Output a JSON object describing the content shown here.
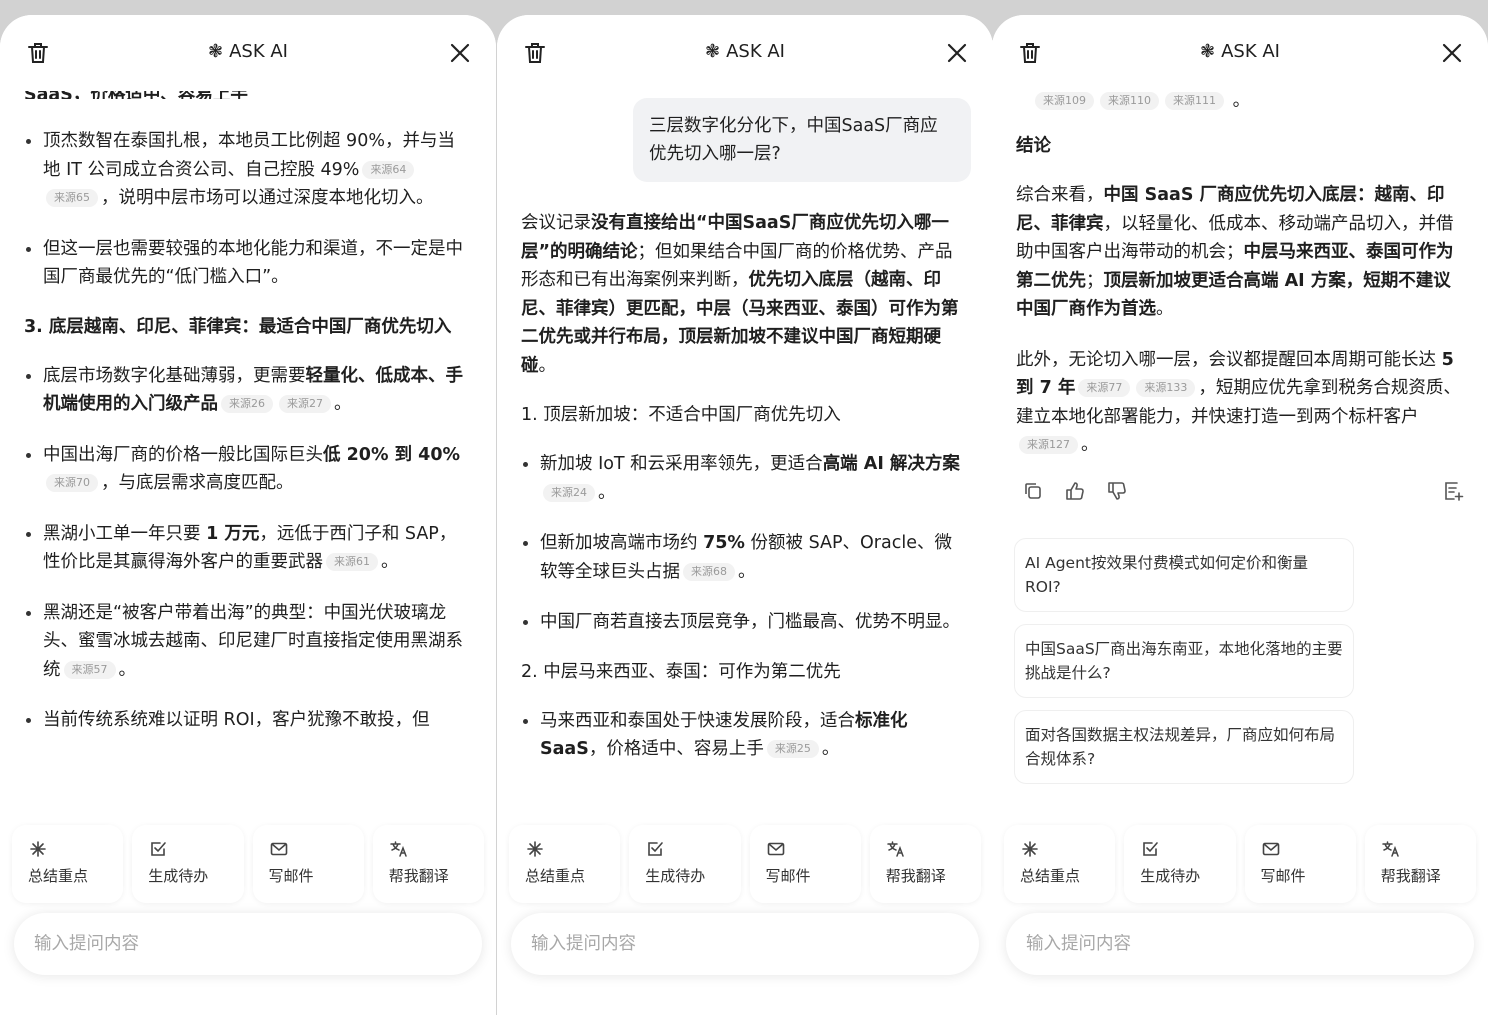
{
  "header": {
    "title": "ASK AI"
  },
  "chips": [
    "总结重点",
    "生成待办",
    "写邮件",
    "帮我翻译"
  ],
  "input": {
    "placeholder": "输入提问内容"
  },
  "panel1": {
    "top_cut": "SaaS，价格适中、容易上手",
    "bullets_a": [
      {
        "text": "顶杰数智在泰国扎根，本地员工比例超 90%，并与当地 IT 公司成立合资公司、自己控股 49%",
        "sources": [
          "来源64",
          "来源65"
        ],
        "tail": "，说明中层市场可以通过深度本地化切入。"
      },
      {
        "text": "但这一层也需要较强的本地化能力和渠道，不一定是中国厂商最优先的“低门槛入口”。"
      }
    ],
    "section3": "3. 底层越南、印尼、菲律宾：最适合中国厂商优先切入",
    "bullets_b": [
      {
        "pre": "底层市场数字化基础薄弱，更需要",
        "bold": "轻量化、低成本、手机端使用的入门级产品",
        "sources": [
          "来源26",
          "来源27"
        ],
        "tail": "。"
      },
      {
        "pre": "中国出海厂商的价格一般比国际巨头",
        "bold": "低 20% 到 40%",
        "sources": [
          "来源70"
        ],
        "tail": "，与底层需求高度匹配。"
      },
      {
        "pre": "黑湖小工单一年只要 ",
        "bold": "1 万元",
        "mid": "，远低于西门子和 SAP，性价比是其赢得海外客户的重要武器",
        "sources": [
          "来源61"
        ],
        "tail": "。"
      },
      {
        "pre": "黑湖还是“被客户带着出海”的典型：中国光伏玻璃龙头、蜜雪冰城去越南、印尼建厂时直接指定使用黑湖系统",
        "sources": [
          "来源57"
        ],
        "tail": "。"
      },
      {
        "pre": "当前传统系统难以证明 ROI，客户犹豫不敢投，但"
      }
    ]
  },
  "panel2": {
    "user_question": "三层数字化分化下，中国SaaS厂商应优先切入哪一层?",
    "answer": {
      "pre": "会议记录",
      "b1": "没有直接给出“中国SaaS厂商应优先切入哪一层”的明确结论",
      "mid": "；但如果结合中国厂商的价格优势、产品形态和已有出海案例来判断，",
      "b2": "优先切入底层（越南、印尼、菲律宾）更匹配，中层（马来西亚、泰国）可作为第二优先或并行布局，顶层新加坡不建议中国厂商短期硬碰",
      "tail": "。"
    },
    "section1": "1. 顶层新加坡：不适合中国厂商优先切入",
    "bullets1": [
      {
        "pre": "新加坡 IoT 和云采用率领先，更适合",
        "bold": "高端 AI 解决方案",
        "sources": [
          "来源24"
        ],
        "tail": "。"
      },
      {
        "pre": "但新加坡高端市场约 ",
        "bold": "75%",
        "mid": " 份额被 SAP、Oracle、微软等全球巨头占据",
        "sources": [
          "来源68"
        ],
        "tail": "。"
      },
      {
        "pre": "中国厂商若直接去顶层竞争，门槛最高、优势不明显。"
      }
    ],
    "section2": "2. 中层马来西亚、泰国：可作为第二优先",
    "bullets2": [
      {
        "pre": "马来西亚和泰国处于快速发展阶段，适合",
        "bold": "标准化 SaaS",
        "mid": "，价格适中、容易上手",
        "sources": [
          "来源25"
        ],
        "tail": "。"
      }
    ]
  },
  "panel3": {
    "top_sources": [
      "来源109",
      "来源110",
      "来源111"
    ],
    "conclusion_title": "结论",
    "conclusion": {
      "pre": "综合来看，",
      "b1": "中国 SaaS 厂商应优先切入底层：越南、印尼、菲律宾",
      "mid": "，以轻量化、低成本、移动端产品切入，并借助中国客户出海带动的机会；",
      "b2": "中层马来西亚、泰国可作为第二优先",
      "sep": "；",
      "b3": "顶层新加坡更适合高端 AI 方案，短期不建议中国厂商作为首选",
      "tail": "。"
    },
    "extra": {
      "pre": "此外，无论切入哪一层，会议都提醒回本周期可能长达 ",
      "bold": "5 到 7 年",
      "sources1": [
        "来源77",
        "来源133"
      ],
      "mid": "，短期应优先拿到税务合规资质、建立本地化部署能力，并快速打造一到两个标杆客户",
      "sources2": [
        "来源127"
      ],
      "tail": "。"
    },
    "suggestions": [
      "AI Agent按效果付费模式如何定价和衡量ROI?",
      "中国SaaS厂商出海东南亚，本地化落地的主要挑战是什么?",
      "面对各国数据主权法规差异，厂商应如何布局合规体系?"
    ]
  }
}
